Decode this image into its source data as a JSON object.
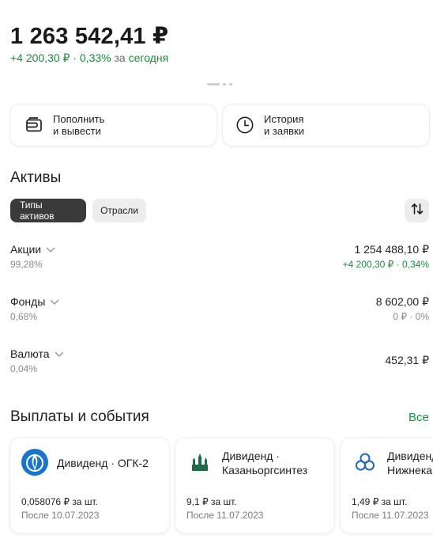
{
  "portfolio": {
    "total": "1 263 542,41 ₽",
    "change_value": "+4 200,30 ₽ · 0,33%",
    "change_connector": "за",
    "change_period": "сегодня"
  },
  "actions": [
    {
      "label": "Пополнить\nи вывести",
      "icon": "wallet-icon"
    },
    {
      "label": "История\nи заявки",
      "icon": "clock-icon"
    }
  ],
  "assets": {
    "title": "Активы",
    "filters": [
      "Типы активов",
      "Отрасли"
    ],
    "active_filter": "Типы активов",
    "sort_icon": "sort-arrows-icon",
    "rows": [
      {
        "name": "Акции",
        "share": "99,28%",
        "value": "1 254 488,10 ₽",
        "delta": "+4 200,30 ₽ · 0,34%",
        "delta_positive": true
      },
      {
        "name": "Фонды",
        "share": "0,68%",
        "value": "8 602,00 ₽",
        "delta": "0 ₽ · 0%",
        "delta_positive": false
      },
      {
        "name": "Валюта",
        "share": "0,04%",
        "value": "452,31 ₽",
        "delta": "",
        "delta_positive": false
      }
    ]
  },
  "events": {
    "title": "Выплаты и события",
    "all_label": "Все",
    "cards": [
      {
        "title": "Дивиденд · ОГК-2",
        "amount": "0,058076 ₽ за шт.",
        "date": "После 10.07.2023",
        "logo": "gazprom-flame-icon"
      },
      {
        "title": "Дивиденд ·\nКазаньоргсинтез",
        "amount": "9,1 ₽ за шт.",
        "date": "После 11.07.2023",
        "logo": "kremlin-icon"
      },
      {
        "title": "Дивиденд ·\nНижнекамскнефтехим",
        "amount": "1,49 ₽ за шт.",
        "date": "После 11.07.2023",
        "logo": "trefoil-icon"
      }
    ]
  },
  "colors": {
    "positive": "#1e8a3b",
    "muted": "#8a8a8a",
    "chip_active": "#3a3a3a"
  }
}
